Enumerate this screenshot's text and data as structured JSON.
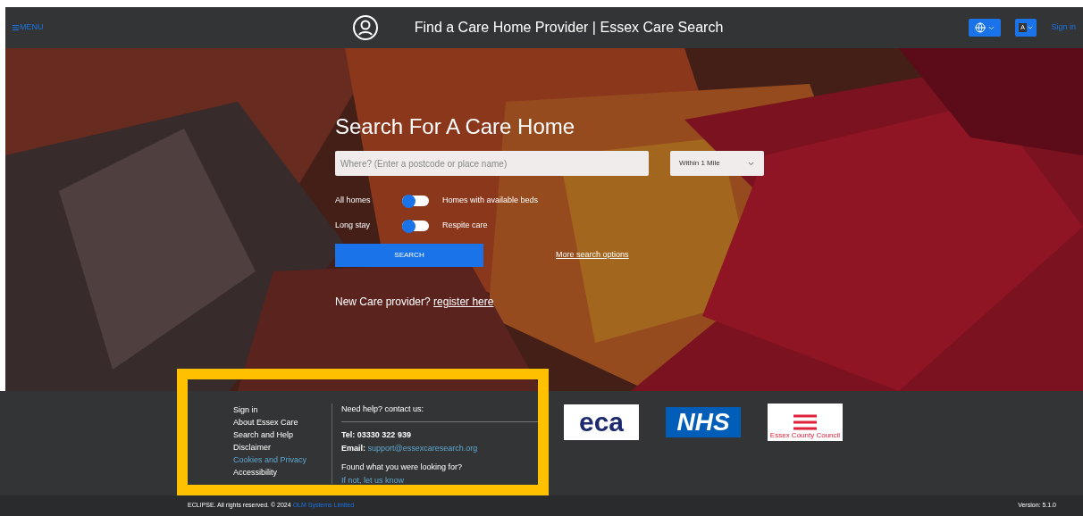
{
  "header": {
    "menu_label": "MENU",
    "title": "Find a Care Home Provider | Essex Care Search",
    "sign_in": "Sign in",
    "text_size_label": "A"
  },
  "search": {
    "heading": "Search For A Care Home",
    "placeholder": "Where? (Enter a postcode or place name)",
    "distance": "Within 1 Mile",
    "toggles": [
      {
        "left": "All homes",
        "right": "Homes with available beds",
        "on": false
      },
      {
        "left": "Long stay",
        "right": "Respite care",
        "on": false
      }
    ],
    "button": "SEARCH",
    "more_options": "More search options",
    "provider_prompt": "New Care provider?",
    "register_link": "register here"
  },
  "footer": {
    "links": [
      {
        "label": "Sign in",
        "highlighted": false
      },
      {
        "label": "About Essex Care",
        "highlighted": false
      },
      {
        "label": "Search and Help",
        "highlighted": false
      },
      {
        "label": "Disclaimer",
        "highlighted": false
      },
      {
        "label": "Cookies and Privacy",
        "highlighted": true
      },
      {
        "label": "Accessibility",
        "highlighted": false
      }
    ],
    "help_heading": "Need help? contact us:",
    "tel": "Tel: 03330 322 939",
    "email_label": "Email:",
    "email": "support@essexcaresearch.org",
    "found_question": "Found what you were looking for?",
    "feedback_link": "If not, let us know",
    "logos": [
      {
        "kind": "eca",
        "text": "eca"
      },
      {
        "kind": "nhs",
        "text": "NHS"
      },
      {
        "kind": "council",
        "text": "Essex County Council"
      }
    ]
  },
  "bottom_bar": {
    "copyright": "ECLIPSE. All rights reserved. © 2024",
    "company_link": "OLM Systems Limited",
    "version": "Version: 5.1.0"
  }
}
